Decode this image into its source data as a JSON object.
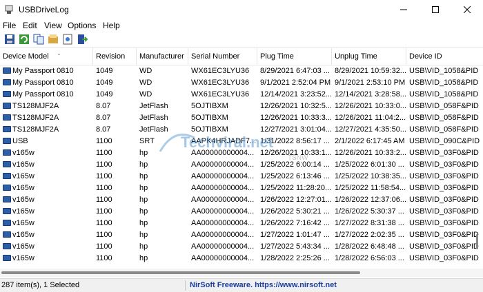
{
  "window": {
    "title": "USBDriveLog"
  },
  "menu": [
    "File",
    "Edit",
    "View",
    "Options",
    "Help"
  ],
  "toolbar": [
    "save-icon",
    "refresh-icon",
    "copy-icon",
    "properties-icon",
    "report-icon",
    "exit-icon"
  ],
  "columns": [
    "Device Model",
    "Revision",
    "Manufacturer",
    "Serial Number",
    "Plug Time",
    "Unplug Time",
    "Device ID"
  ],
  "rows": [
    [
      "My Passport 0810",
      "1049",
      "WD",
      "WX61EC3LYU36",
      "8/29/2021 6:47:03 ...",
      "8/29/2021 10:59:32...",
      "USB\\VID_1058&PID"
    ],
    [
      "My Passport 0810",
      "1049",
      "WD",
      "WX61EC3LYU36",
      "9/1/2021 2:52:04 PM",
      "9/1/2021 2:53:10 PM",
      "USB\\VID_1058&PID"
    ],
    [
      "My Passport 0810",
      "1049",
      "WD",
      "WX61EC3LYU36",
      "12/14/2021 3:23:52...",
      "12/14/2021 3:28:58...",
      "USB\\VID_1058&PID"
    ],
    [
      "TS128MJF2A",
      "8.07",
      "JetFlash",
      "5OJTIBXM",
      "12/26/2021 10:32:5...",
      "12/26/2021 10:33:0...",
      "USB\\VID_058F&PID"
    ],
    [
      "TS128MJF2A",
      "8.07",
      "JetFlash",
      "5OJTIBXM",
      "12/26/2021 10:33:3...",
      "12/26/2021 11:04:2...",
      "USB\\VID_058F&PID"
    ],
    [
      "TS128MJF2A",
      "8.07",
      "JetFlash",
      "5OJTIBXM",
      "12/27/2021 3:01:04...",
      "12/27/2021 4:35:50...",
      "USB\\VID_058F&PID"
    ],
    [
      "USB",
      "1100",
      "SRT",
      "AAPK4HRJADF7...",
      "1/31/2022 8:56:17 ...",
      "2/1/2022 6:17:45 AM",
      "USB\\VID_090C&PID"
    ],
    [
      "v165w",
      "1100",
      "hp",
      "AA00000000004...",
      "12/26/2021 10:33:1...",
      "12/26/2021 10:33:2...",
      "USB\\VID_03F0&PID"
    ],
    [
      "v165w",
      "1100",
      "hp",
      "AA00000000004...",
      "1/25/2022 6:00:14 ...",
      "1/25/2022 6:01:30 ...",
      "USB\\VID_03F0&PID"
    ],
    [
      "v165w",
      "1100",
      "hp",
      "AA00000000004...",
      "1/25/2022 6:13:46 ...",
      "1/25/2022 10:38:35...",
      "USB\\VID_03F0&PID"
    ],
    [
      "v165w",
      "1100",
      "hp",
      "AA00000000004...",
      "1/25/2022 11:28:20...",
      "1/25/2022 11:58:54...",
      "USB\\VID_03F0&PID"
    ],
    [
      "v165w",
      "1100",
      "hp",
      "AA00000000004...",
      "1/26/2022 12:27:01...",
      "1/26/2022 12:37:06...",
      "USB\\VID_03F0&PID"
    ],
    [
      "v165w",
      "1100",
      "hp",
      "AA00000000004...",
      "1/26/2022 5:30:21 ...",
      "1/26/2022 5:30:37 ...",
      "USB\\VID_03F0&PID"
    ],
    [
      "v165w",
      "1100",
      "hp",
      "AA00000000004...",
      "1/26/2022 7:16:42 ...",
      "1/27/2022 8:31:38 ...",
      "USB\\VID_03F0&PID"
    ],
    [
      "v165w",
      "1100",
      "hp",
      "AA00000000004...",
      "1/27/2022 1:01:47 ...",
      "1/27/2022 2:02:35 ...",
      "USB\\VID_03F0&PID"
    ],
    [
      "v165w",
      "1100",
      "hp",
      "AA00000000004...",
      "1/27/2022 5:43:34 ...",
      "1/28/2022 6:48:48 ...",
      "USB\\VID_03F0&PID"
    ],
    [
      "v165w",
      "1100",
      "hp",
      "AA00000000004...",
      "1/28/2022 2:25:26 ...",
      "1/28/2022 6:56:03 ...",
      "USB\\VID_03F0&PID"
    ]
  ],
  "status": {
    "items": "287 item(s), 1 Selected",
    "link": "NirSoft Freeware. https://www.nirsoft.net"
  },
  "watermark": {
    "main": "Techviral.net",
    "sub": "TSNW"
  }
}
